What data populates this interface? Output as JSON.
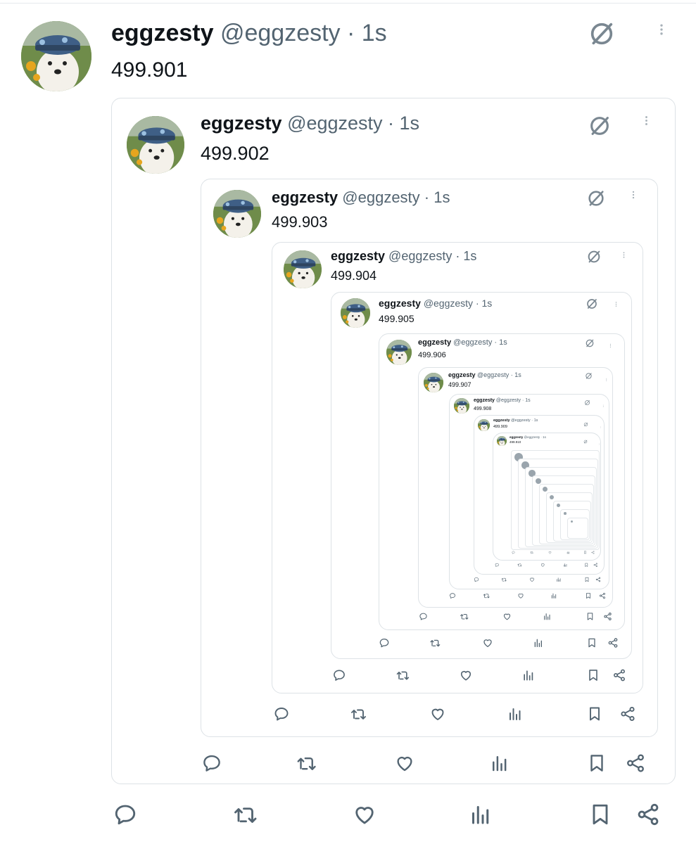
{
  "tweets": [
    {
      "name": "eggzesty",
      "handle": "@eggzesty · 1s",
      "text": "499.901"
    },
    {
      "name": "eggzesty",
      "handle": "@eggzesty · 1s",
      "text": "499.902"
    },
    {
      "name": "eggzesty",
      "handle": "@eggzesty · 1s",
      "text": "499.903"
    },
    {
      "name": "eggzesty",
      "handle": "@eggzesty · 1s",
      "text": "499.904"
    },
    {
      "name": "eggzesty",
      "handle": "@eggzesty · 1s",
      "text": "499.905"
    },
    {
      "name": "eggzesty",
      "handle": "@eggzesty · 1s",
      "text": "499.906"
    },
    {
      "name": "eggzesty",
      "handle": "@eggzesty · 1s",
      "text": "499.907"
    },
    {
      "name": "eggzesty",
      "handle": "@eggzesty · 1s",
      "text": "499.908"
    },
    {
      "name": "eggzesty",
      "handle": "@eggzesty · 1s",
      "text": "499.909"
    },
    {
      "name": "eggzesty",
      "handle": "@eggzesty · 1s",
      "text": "499.910"
    }
  ],
  "icons": {
    "no_symbol": "slashed-circle-icon",
    "more": "more-vertical-icon",
    "reply": "reply-icon",
    "retweet": "retweet-icon",
    "like": "heart-icon",
    "views": "views-icon",
    "bookmark": "bookmark-icon",
    "share": "share-icon"
  },
  "colors": {
    "text": "#0f1419",
    "secondary": "#536471",
    "border": "#dde2e6",
    "background": "#ffffff"
  }
}
